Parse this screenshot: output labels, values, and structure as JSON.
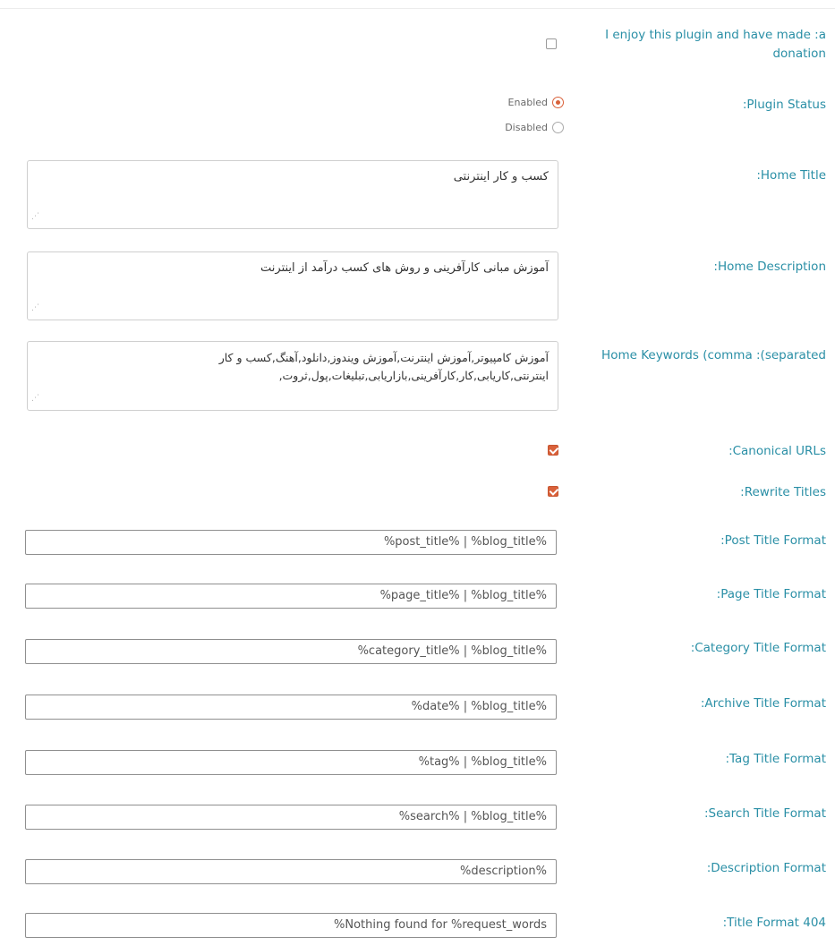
{
  "donation": {
    "label": "I enjoy this plugin and have made :a donation",
    "checked": false
  },
  "plugin_status": {
    "label": ":Plugin Status",
    "options": [
      {
        "label": "Enabled",
        "selected": true
      },
      {
        "label": "Disabled",
        "selected": false
      }
    ]
  },
  "home_title": {
    "label": ":Home Title",
    "value": "کسب و کار اینترنتی"
  },
  "home_description": {
    "label": ":Home Description",
    "value": "آموزش مبانی کارآفرینی و روش های کسب درآمد از اینترنت"
  },
  "home_keywords": {
    "label": "Home Keywords (comma :(separated",
    "value": "آموزش کامپیوتر,آموزش اینترنت,آموزش ویندوز,دانلود,آهنگ,کسب و کار اینترنتی,کاریابی,کار,کارآفرینی,بازاریابی,تبلیغات,پول,ثروت,"
  },
  "canonical_urls": {
    "label": ":Canonical URLs",
    "checked": true
  },
  "rewrite_titles": {
    "label": ":Rewrite Titles",
    "checked": true
  },
  "formats": [
    {
      "label": ":Post Title Format",
      "value": "%post_title% | %blog_title%"
    },
    {
      "label": ":Page Title Format",
      "value": "%page_title% | %blog_title%"
    },
    {
      "label": ":Category Title Format",
      "value": "%category_title% | %blog_title%"
    },
    {
      "label": ":Archive Title Format",
      "value": "%date% | %blog_title%"
    },
    {
      "label": ":Tag Title Format",
      "value": "%tag% | %blog_title%"
    },
    {
      "label": ":Search Title Format",
      "value": "%search% | %blog_title%"
    },
    {
      "label": ":Description Format",
      "value": "%description%"
    },
    {
      "label": ":Title Format 404",
      "value": "%Nothing found for %request_words"
    }
  ],
  "colors": {
    "label": "#2a8fa6",
    "accent": "#d9613a"
  }
}
